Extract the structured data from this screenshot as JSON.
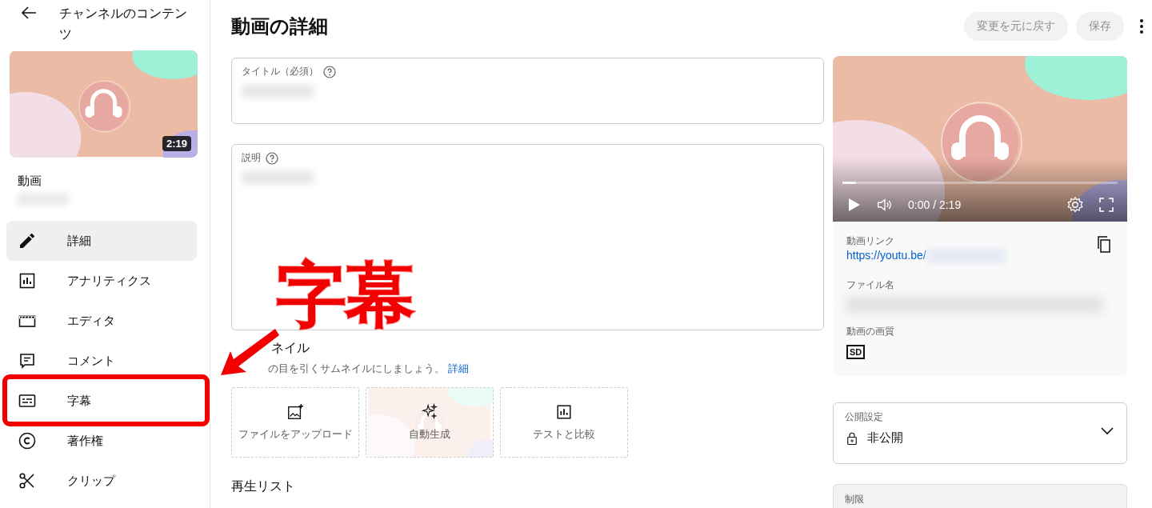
{
  "sidebar": {
    "header": "チャンネルのコンテンツ",
    "thumbnail": {
      "kind": "picture",
      "duration": "2:19"
    },
    "video_label": "動画",
    "nav": [
      {
        "label": "詳細",
        "selected": true,
        "highlighted": false
      },
      {
        "label": "アナリティクス",
        "selected": false,
        "highlighted": false
      },
      {
        "label": "エディタ",
        "selected": false,
        "highlighted": false
      },
      {
        "label": "コメント",
        "selected": false,
        "highlighted": false
      },
      {
        "label": "字幕",
        "selected": false,
        "highlighted": true
      },
      {
        "label": "著作権",
        "selected": false,
        "highlighted": false
      },
      {
        "label": "クリップ",
        "selected": false,
        "highlighted": false
      }
    ]
  },
  "main": {
    "title": "動画の詳細",
    "fields": [
      {
        "label": "タイトル（必須）"
      },
      {
        "label": "説明"
      }
    ],
    "thumbnail_section": {
      "heading": "ネイル",
      "hint": "の目を引くサムネイルにしましょう。",
      "link": "詳細",
      "options": [
        {
          "label": "ファイルをアップロード"
        },
        {
          "label": "自動生成"
        },
        {
          "label": "テストと比較"
        }
      ]
    },
    "playlist_heading": "再生リスト"
  },
  "panel": {
    "buttons": [
      {
        "label": "変更を元に戻す",
        "disabled": true
      },
      {
        "label": "保存",
        "disabled": true
      }
    ],
    "player": {
      "kind": "picture",
      "time": "0:00 / 2:19",
      "level": 0.05
    },
    "info": {
      "link_label": "動画リンク",
      "link": "https://youtu.be/",
      "file_label": "ファイル名",
      "quality_label": "動画の画質",
      "quality": "SD"
    },
    "visibility": {
      "label": "公開設定",
      "value": "非公開"
    },
    "restriction": {
      "label": "制限"
    }
  },
  "annotation": {
    "callout": "字幕"
  }
}
